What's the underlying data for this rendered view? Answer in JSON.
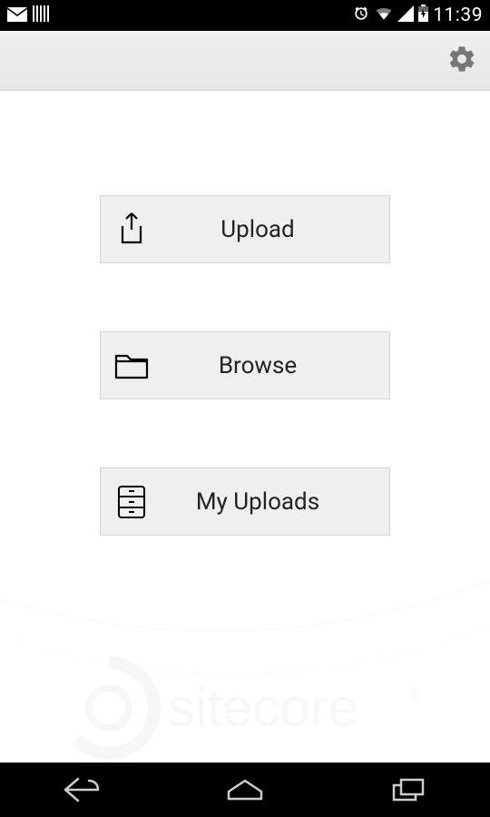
{
  "status": {
    "time": "11:39"
  },
  "menu": {
    "upload_label": "Upload",
    "browse_label": "Browse",
    "myuploads_label": "My Uploads"
  },
  "brand": {
    "watermark": "sitecore"
  }
}
